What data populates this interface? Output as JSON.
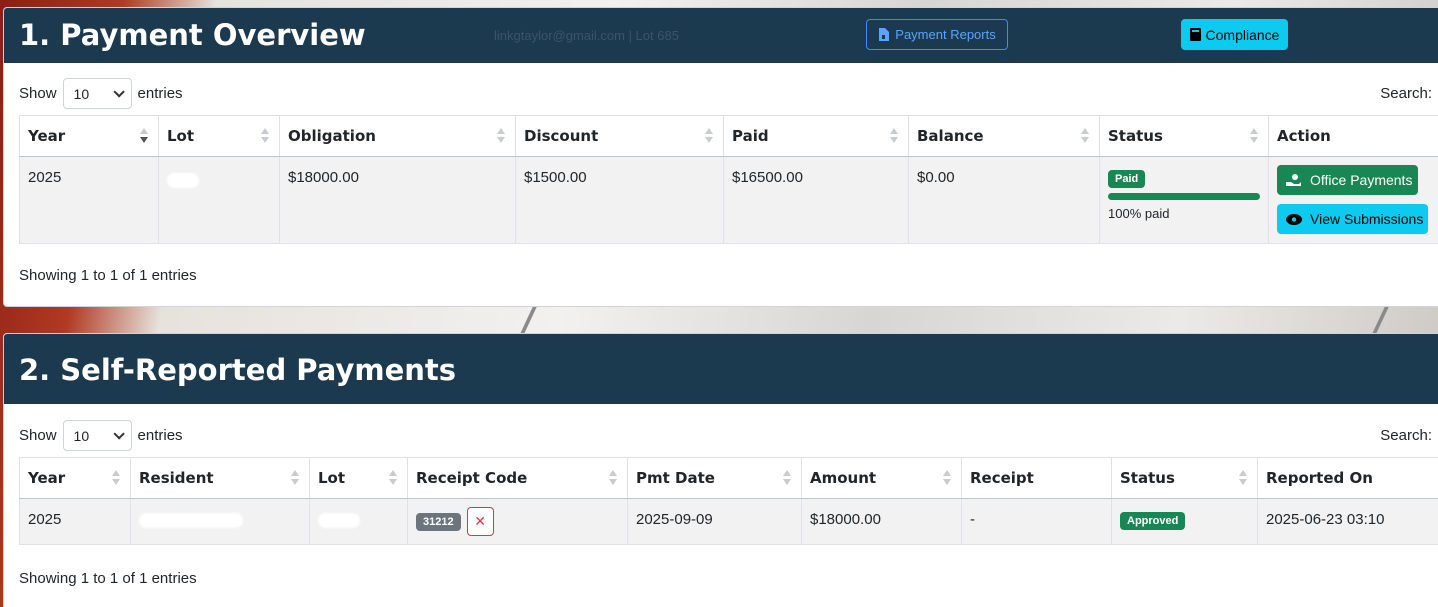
{
  "header": {
    "title": "1. Payment Overview",
    "user_info": "linkgtaylor@gmail.com | Lot 685",
    "reports_label": "Payment Reports",
    "compliance_label": "Compliance"
  },
  "colors": {
    "header_bg": "#1b3a4f",
    "success": "#198754",
    "info": "#0dcaf0",
    "danger": "#dc3545"
  },
  "overview": {
    "show_label": "Show",
    "entries_label": "entries",
    "page_size": "10",
    "search_label": "Search:",
    "columns": [
      "Year",
      "Lot",
      "Obligation",
      "Discount",
      "Paid",
      "Balance",
      "Status",
      "Action"
    ],
    "row": {
      "year": "2025",
      "obligation": "$18000.00",
      "discount": "$1500.00",
      "paid": "$16500.00",
      "balance": "$0.00",
      "status": "Paid",
      "progress_percent": 100,
      "progress_text": "100% paid",
      "office_payments_label": "Office Payments",
      "view_submissions_label": "View Submissions"
    },
    "footer": "Showing 1 to 1 of 1 entries"
  },
  "self_reported": {
    "title": "2. Self-Reported Payments",
    "show_label": "Show",
    "entries_label": "entries",
    "page_size": "10",
    "search_label": "Search:",
    "columns": [
      "Year",
      "Resident",
      "Lot",
      "Receipt Code",
      "Pmt Date",
      "Amount",
      "Receipt",
      "Status",
      "Reported On"
    ],
    "row": {
      "year": "2025",
      "receipt_code": "31212",
      "pmt_date": "2025-09-09",
      "amount": "$18000.00",
      "receipt": "-",
      "status": "Approved",
      "reported_on": "2025-06-23 03:10"
    },
    "footer": "Showing 1 to 1 of 1 entries"
  }
}
